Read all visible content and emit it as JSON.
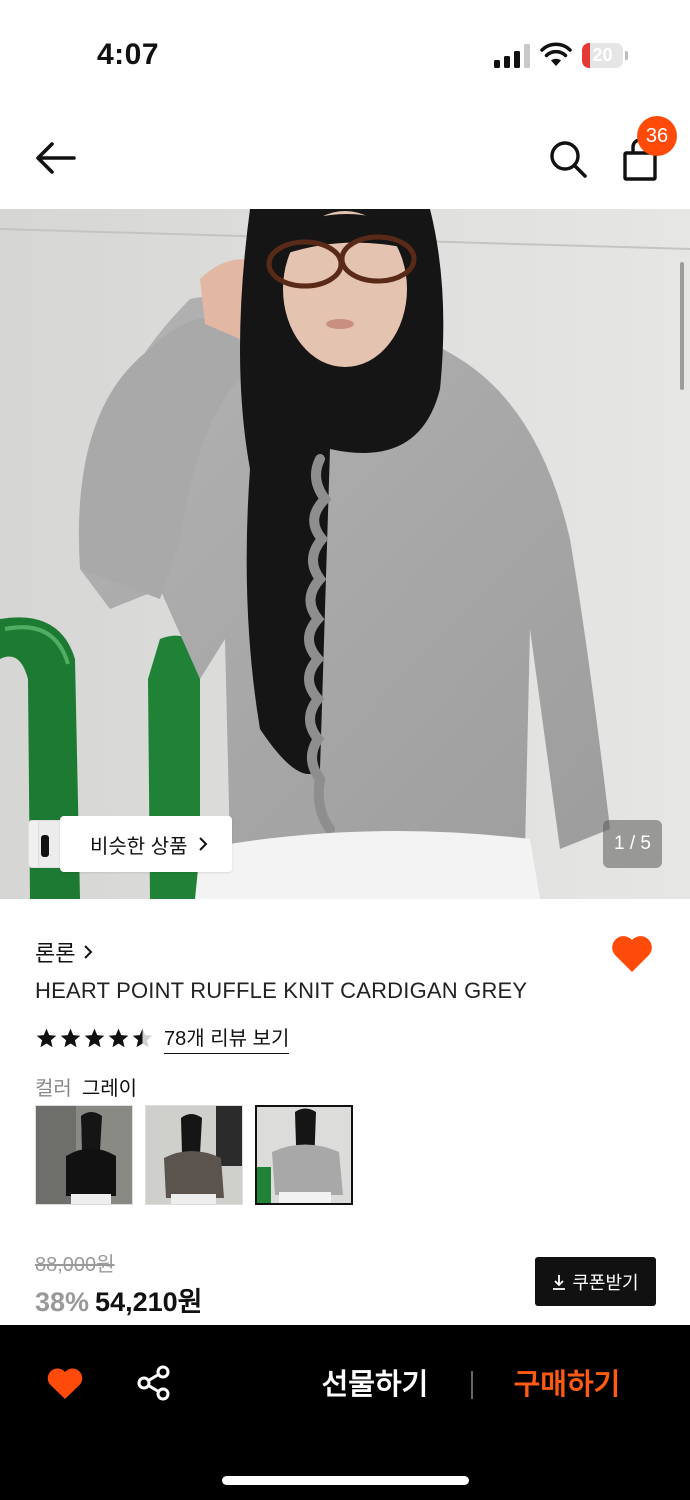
{
  "status_bar": {
    "time": "4:07",
    "battery": "20",
    "battery_level": 0.2
  },
  "nav": {
    "cart_count": "36",
    "icons": [
      "back-arrow-icon",
      "search-icon",
      "shopping-bag-icon"
    ]
  },
  "gallery": {
    "similar_label": "비슷한 상품",
    "counter": "1 / 5"
  },
  "product": {
    "brand": "론론",
    "title": "HEART POINT RUFFLE KNIT CARDIGAN GREY",
    "rating": 4.5,
    "review_link": "78개 리뷰 보기",
    "color_label": "컬러",
    "color_value": "그레이",
    "swatches": [
      "black",
      "brown",
      "grey"
    ],
    "selected_swatch": "grey"
  },
  "price": {
    "original": "88,000원",
    "discount": "38%",
    "final": "54,210원",
    "coupon_label": "쿠폰받기"
  },
  "bottom_bar": {
    "gift_label": "선물하기",
    "buy_label": "구매하기"
  },
  "colors": {
    "accent": "#ff4b0a",
    "heart": "#ff4b0a",
    "buy": "#ff5a14"
  }
}
